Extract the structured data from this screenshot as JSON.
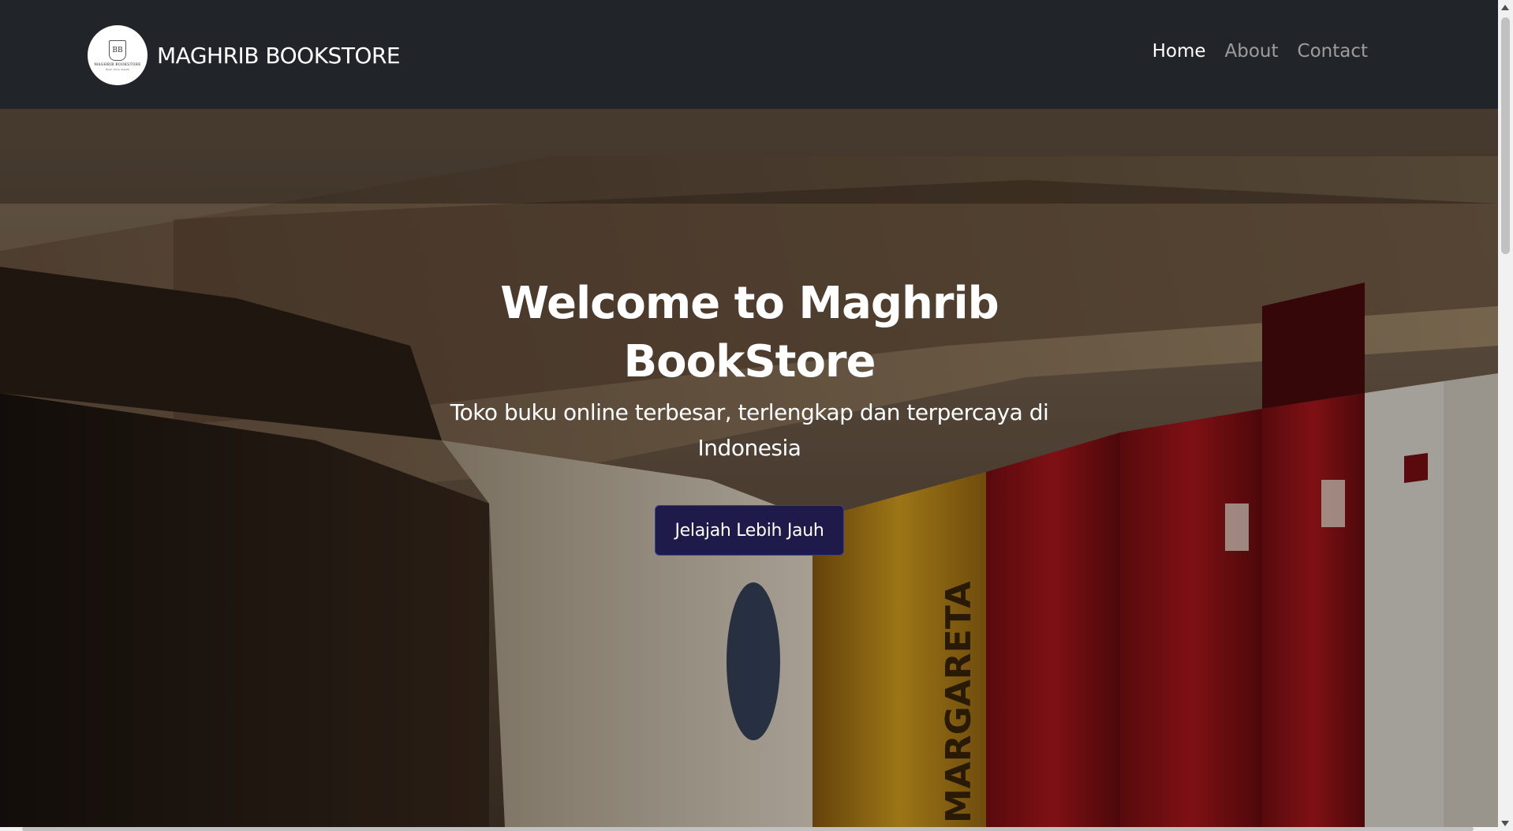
{
  "brand": {
    "name": "MAGHRIB BOOKSTORE",
    "logo_text": "MAGHRIB BOOKSTORE",
    "logo_sub": "Read, Grow, Inspire",
    "logo_crest": "BB"
  },
  "nav": {
    "items": [
      {
        "label": "Home",
        "active": true
      },
      {
        "label": "About",
        "active": false
      },
      {
        "label": "Contact",
        "active": false
      }
    ]
  },
  "hero": {
    "title": "Welcome to Maghrib BookStore",
    "subtitle": "Toko buku online terbesar, terlengkap dan terpercaya di Indonesia",
    "cta_label": "Jelajah Lebih Jauh",
    "spine_text": "MARGARETA"
  },
  "colors": {
    "navbar": "#212529",
    "cta_bg": "#1e1a4a",
    "cta_border": "#3b3fa0"
  }
}
